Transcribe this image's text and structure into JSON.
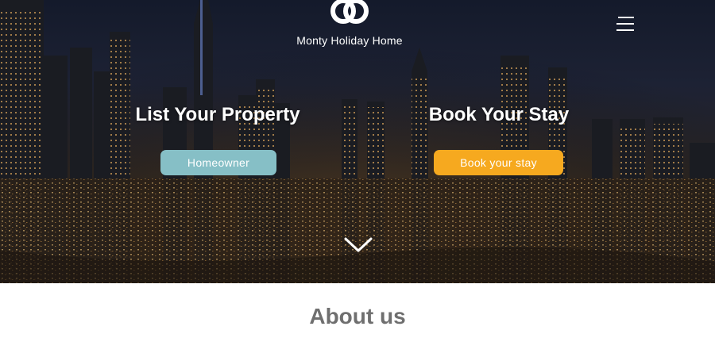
{
  "brand": {
    "name": "Monty Holiday Home",
    "logo": "linked-rings-logo-icon"
  },
  "nav": {
    "menu_icon": "hamburger-menu-icon"
  },
  "hero": {
    "left": {
      "heading": "List Your Property",
      "button_label": "Homeowner"
    },
    "right": {
      "heading": "Book Your Stay",
      "button_label": "Book your stay"
    },
    "scroll_icon": "chevron-down-icon"
  },
  "about": {
    "title": "About us"
  },
  "colors": {
    "homeowner_button": "#86bfc6",
    "book_button": "#f6a91f",
    "about_text": "#6f6f6f",
    "text_on_hero": "#ffffff"
  }
}
